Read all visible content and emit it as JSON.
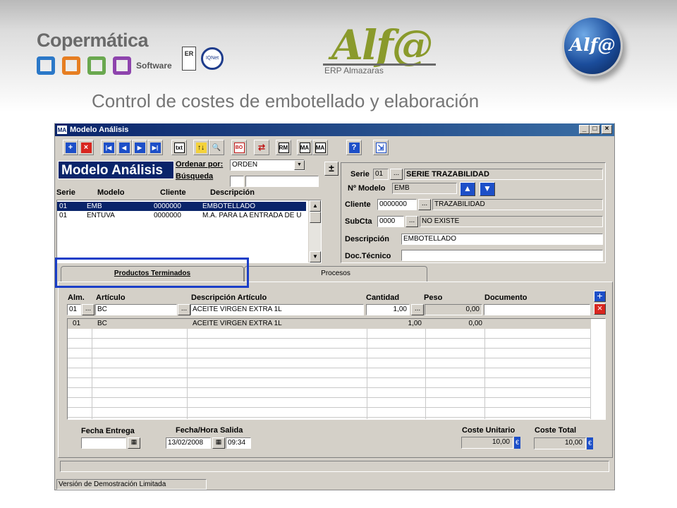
{
  "brand": {
    "company": "Copermática",
    "software": "Software",
    "cert_er": "ER",
    "cert_iq": "IQNet",
    "product": "Alf@",
    "product_sub": "ERP Almazaras",
    "globe": "Alf@",
    "square_colors": [
      "#2b78c8",
      "#e67e22",
      "#6aa84f",
      "#8e44ad"
    ]
  },
  "slide_title": "Control de costes de embotellado y elaboración",
  "window": {
    "title": "Modelo Análisis",
    "app_icon": "MA",
    "buttons": {
      "minimize": "_",
      "maximize": "□",
      "close": "×"
    }
  },
  "toolbar": {
    "add": "+",
    "delete": "×",
    "first": "|◀",
    "prev": "◀",
    "next": "▶",
    "last": "▶|",
    "txt": "txt",
    "sort": "↑↓",
    "search": "🔍",
    "bo": "BO",
    "swap": "⇄",
    "rm": "RM",
    "ma1": "MA",
    "ma2": "MA",
    "help": "?",
    "exit": "⇲"
  },
  "header": {
    "heading": "Modelo Análisis",
    "order_label": "Ordenar por:",
    "order_value": "ORDEN",
    "search_label": "Búsqueda",
    "search_value": "",
    "search_prefix": "",
    "plusminus": "±"
  },
  "list": {
    "columns": [
      "Serie",
      "Modelo",
      "Cliente",
      "Descripción"
    ],
    "rows": [
      {
        "serie": "01",
        "modelo": "EMB",
        "cliente": "0000000",
        "desc": "EMBOTELLADO"
      },
      {
        "serie": "01",
        "modelo": "ENTUVA",
        "cliente": "0000000",
        "desc": "M.A. PARA LA ENTRADA DE U"
      }
    ]
  },
  "form": {
    "serie_label": "Serie",
    "serie_code": "01",
    "serie_desc": "SERIE TRAZABILIDAD",
    "modelo_label": "Nº Modelo",
    "modelo_value": "EMB",
    "cliente_label": "Cliente",
    "cliente_code": "0000000",
    "cliente_desc": "TRAZABILIDAD",
    "subcta_label": "SubCta",
    "subcta_code": "0000",
    "subcta_desc": "NO EXISTE",
    "desc_label": "Descripción",
    "desc_value": "EMBOTELLADO",
    "doc_label": "Doc.Técnico",
    "doc_value": "",
    "dots": "..."
  },
  "tabs": [
    {
      "label": "Productos Terminados"
    },
    {
      "label": "Procesos"
    }
  ],
  "products": {
    "columns": [
      "Alm.",
      "Artículo",
      "Descripción Artículo",
      "Cantidad",
      "Peso",
      "Documento"
    ],
    "edit": {
      "alm": "01",
      "articulo": "BC",
      "descripcion": "ACEITE VIRGEN EXTRA 1L",
      "cantidad": "1,00",
      "peso": "0,00",
      "documento": ""
    },
    "rows": [
      {
        "alm": "01",
        "articulo": "BC",
        "descripcion": "ACEITE VIRGEN EXTRA 1L",
        "cantidad": "1,00",
        "peso": "0,00"
      }
    ],
    "add": "+",
    "remove": "×"
  },
  "footer": {
    "fecha_entrega_label": "Fecha Entrega",
    "fecha_entrega_value": "",
    "fecha_salida_label": "Fecha/Hora Salida",
    "fecha_salida_value": "13/02/2008",
    "hora_salida_value": "09:34",
    "coste_unitario_label": "Coste Unitario",
    "coste_unitario_value": "10,00",
    "coste_total_label": "Coste Total",
    "coste_total_value": "10,00",
    "currency": "€",
    "calendar": "📅"
  },
  "status": {
    "text": "Versión de Demostración Limitada"
  }
}
